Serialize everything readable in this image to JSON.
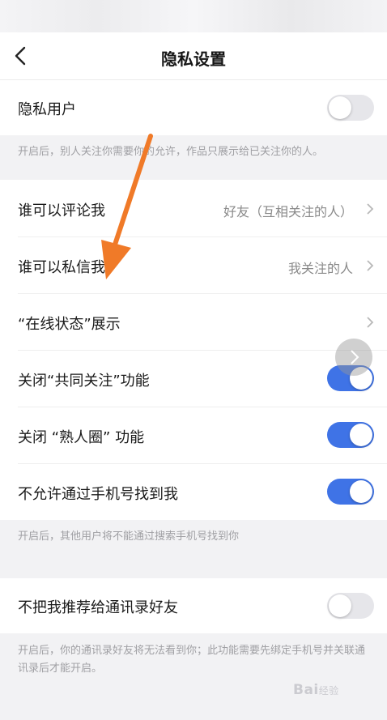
{
  "nav": {
    "title": "隐私设置"
  },
  "private_user": {
    "label": "隐私用户",
    "enabled": false
  },
  "private_user_note": "开启后，别人关注你需要你的允许，作品只展示给已关注你的人。",
  "comment": {
    "label": "谁可以评论我",
    "value": "好友（互相关注的人）"
  },
  "message": {
    "label": "谁可以私信我",
    "value": "我关注的人"
  },
  "online_status": {
    "label": "“在线状态”展示"
  },
  "close_common_follow": {
    "label": "关闭“共同关注”功能",
    "enabled": true
  },
  "close_acquaintance": {
    "label": "关闭 “熟人圈” 功能",
    "enabled": true
  },
  "no_phone_find": {
    "label": "不允许通过手机号找到我",
    "enabled": true
  },
  "phone_note": "开启后，其他用户将不能通过搜索手机号找到你",
  "no_contacts_recommend": {
    "label": "不把我推荐给通讯录好友",
    "enabled": false
  },
  "contacts_note": "开启后，你的通讯录好友将无法看到你；此功能需要先绑定手机号并关联通讯录后才能开启。",
  "watermark": {
    "brand": "Bai",
    "suffix": "经验"
  },
  "colors": {
    "accent": "#3f73e6",
    "annotation_arrow": "#f07a28"
  },
  "icons": [
    "back-arrow-icon",
    "chevron-right-icon",
    "annotation-arrow-icon"
  ]
}
